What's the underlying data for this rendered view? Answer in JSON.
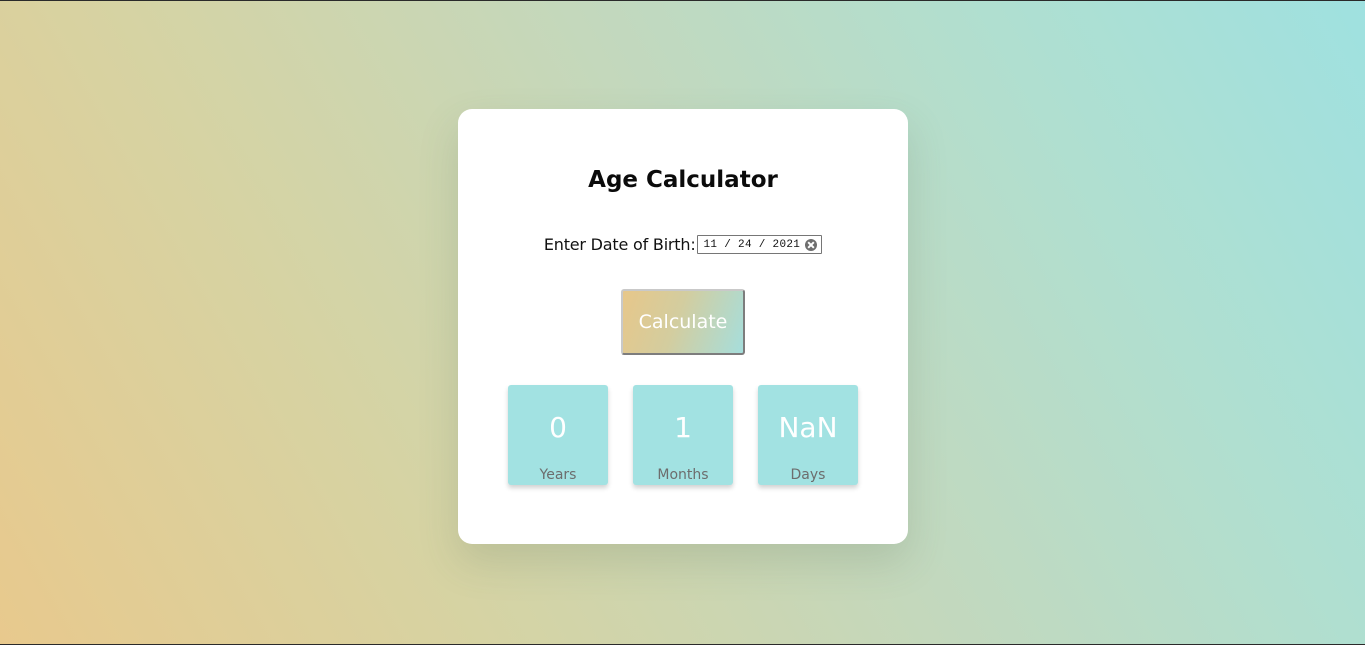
{
  "app": {
    "title": "Age Calculator"
  },
  "form": {
    "dob_label": "Enter Date of Birth:",
    "dob_value": "11 / 24 / 2021",
    "calculate_label": "Calculate"
  },
  "results": [
    {
      "value": "0",
      "label": "Years"
    },
    {
      "value": "1",
      "label": "Months"
    },
    {
      "value": "NaN",
      "label": "Days"
    }
  ],
  "colors": {
    "card_background": "#ffffff",
    "result_box": "#a2e2e2",
    "gradient_start": "#e8c98d",
    "gradient_end": "#9fe1e0"
  },
  "icons": {
    "clear": "clear-circle-x-icon"
  }
}
